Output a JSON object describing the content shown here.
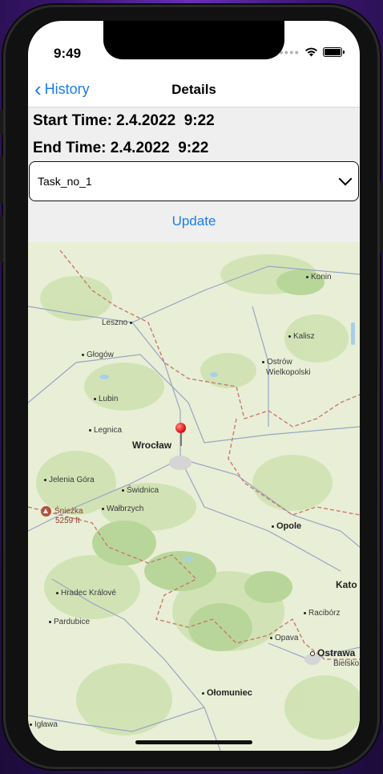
{
  "status": {
    "time": "9:49"
  },
  "nav": {
    "back_label": "History",
    "title": "Details"
  },
  "details": {
    "start_time": "Start Time: 2.4.2022  9:22",
    "end_time": "End Time: 2.4.2022  9:22",
    "task_select": {
      "value": "Task_no_1"
    },
    "update_label": "Update"
  },
  "map": {
    "labels": [
      {
        "id": "konin",
        "text": "Konin"
      },
      {
        "id": "leszno",
        "text": "Leszno"
      },
      {
        "id": "kalisz",
        "text": "Kalisz"
      },
      {
        "id": "glogow",
        "text": "Głogów"
      },
      {
        "id": "ostrow1",
        "text": "Ostrów"
      },
      {
        "id": "ostrow2",
        "text": "Wielkopolski"
      },
      {
        "id": "lubin",
        "text": "Lubin"
      },
      {
        "id": "legnica",
        "text": "Legnica"
      },
      {
        "id": "wroclaw",
        "text": "Wrocław"
      },
      {
        "id": "jelenia",
        "text": "Jelenia Góra"
      },
      {
        "id": "swidnica",
        "text": "Świdnica"
      },
      {
        "id": "walbrzych",
        "text": "Wałbrzych"
      },
      {
        "id": "sniezka",
        "text": "Śnieżka"
      },
      {
        "id": "sniezka_h",
        "text": "5259 ft"
      },
      {
        "id": "opole",
        "text": "Opole"
      },
      {
        "id": "kato",
        "text": "Kato"
      },
      {
        "id": "hradec",
        "text": "Hradec Králové"
      },
      {
        "id": "raciborz",
        "text": "Racibórz"
      },
      {
        "id": "pardubice",
        "text": "Pardubice"
      },
      {
        "id": "opava",
        "text": "Opava"
      },
      {
        "id": "ostrawa",
        "text": "Ostrawa"
      },
      {
        "id": "bielsko",
        "text": "Bielsko"
      },
      {
        "id": "olomuniec",
        "text": "Ołomuniec"
      },
      {
        "id": "iglawa",
        "text": "Igława"
      }
    ]
  }
}
